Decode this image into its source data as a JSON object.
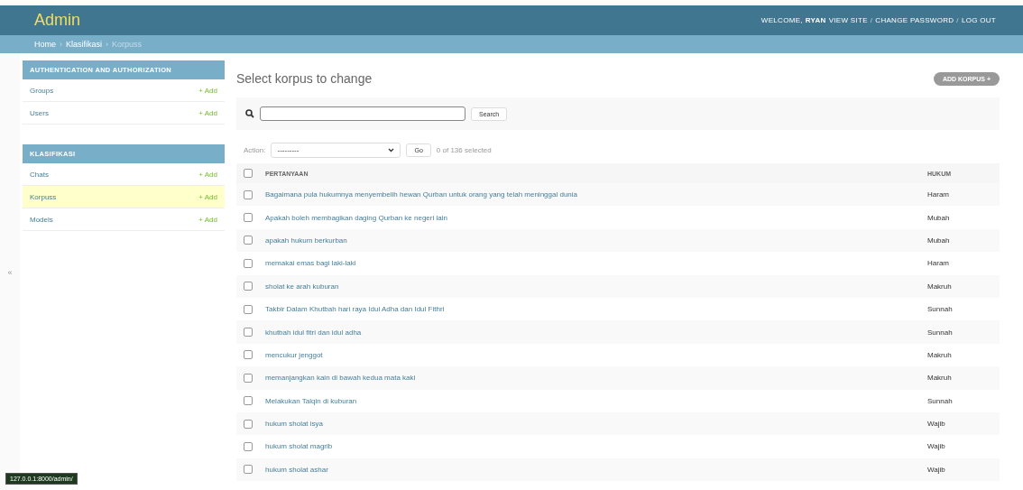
{
  "header": {
    "title": "Admin",
    "welcome": "WELCOME,",
    "user": "RYAN",
    "links": [
      {
        "kind": "link",
        "text": "VIEW SITE"
      },
      {
        "kind": "separator",
        "text": "/"
      },
      {
        "kind": "link",
        "text": "CHANGE PASSWORD"
      },
      {
        "kind": "separator",
        "text": "/"
      },
      {
        "kind": "link",
        "text": "LOG OUT"
      }
    ]
  },
  "breadcrumbs": [
    {
      "kind": "link",
      "text": "Home"
    },
    {
      "kind": "separator",
      "text": "›"
    },
    {
      "kind": "link",
      "text": "Klasifikasi"
    },
    {
      "kind": "separator",
      "text": "›"
    },
    {
      "kind": "current",
      "text": "Korpuss"
    }
  ],
  "sidebar": {
    "toggle": "«",
    "groups": [
      {
        "title": "AUTHENTICATION AND AUTHORIZATION",
        "items": [
          {
            "label": "Groups",
            "add": "+ Add",
            "selected": false
          },
          {
            "label": "Users",
            "add": "+ Add",
            "selected": false
          }
        ]
      },
      {
        "title": "KLASIFIKASI",
        "items": [
          {
            "label": "Chats",
            "add": "+ Add",
            "selected": false
          },
          {
            "label": "Korpuss",
            "add": "+ Add",
            "selected": true
          },
          {
            "label": "Models",
            "add": "+ Add",
            "selected": false
          }
        ]
      }
    ]
  },
  "content": {
    "title": "Select korpus to change",
    "add_button": "ADD KORPUS +",
    "search": {
      "button": "Search"
    },
    "actions": {
      "label": "Action:",
      "value": "---------",
      "go": "Go",
      "counter": "0 of 136 selected"
    },
    "table": {
      "columns": [
        "PERTANYAAN",
        "HUKUM"
      ],
      "header_checked": false,
      "rows": [
        {
          "checked": false,
          "cells": [
            "Bagaimana pula hukumnya menyembelih hewan Qurban untuk orang yang telah meninggal dunia",
            "Haram"
          ]
        },
        {
          "checked": false,
          "cells": [
            "Apakah boleh membagikan daging Qurban ke negeri lain",
            "Mubah"
          ]
        },
        {
          "checked": false,
          "cells": [
            "apakah hukum berkurban",
            "Mubah"
          ]
        },
        {
          "checked": false,
          "cells": [
            "memakai emas bagi laki-laki",
            "Haram"
          ]
        },
        {
          "checked": false,
          "cells": [
            "sholat ke arah kuburan",
            "Makruh"
          ]
        },
        {
          "checked": false,
          "cells": [
            "Takbir Dalam Khutbah hari raya Idul Adha dan Idul Fithri",
            "Sunnah"
          ]
        },
        {
          "checked": false,
          "cells": [
            "khutbah idul fitri dan idul adha",
            "Sunnah"
          ]
        },
        {
          "checked": false,
          "cells": [
            "mencukur jenggot",
            "Makruh"
          ]
        },
        {
          "checked": false,
          "cells": [
            "memanjangkan kain di bawah kedua mata kaki",
            "Makruh"
          ]
        },
        {
          "checked": false,
          "cells": [
            "Melakukan Talqin di kuburan",
            "Sunnah"
          ]
        },
        {
          "checked": false,
          "cells": [
            "hukum sholat isya",
            "Wajib"
          ]
        },
        {
          "checked": false,
          "cells": [
            "hukum sholat magrib",
            "Wajib"
          ]
        },
        {
          "checked": false,
          "cells": [
            "hukum sholat ashar",
            "Wajib"
          ]
        }
      ]
    }
  },
  "status_bar": "127.0.0.1:8000/admin/"
}
